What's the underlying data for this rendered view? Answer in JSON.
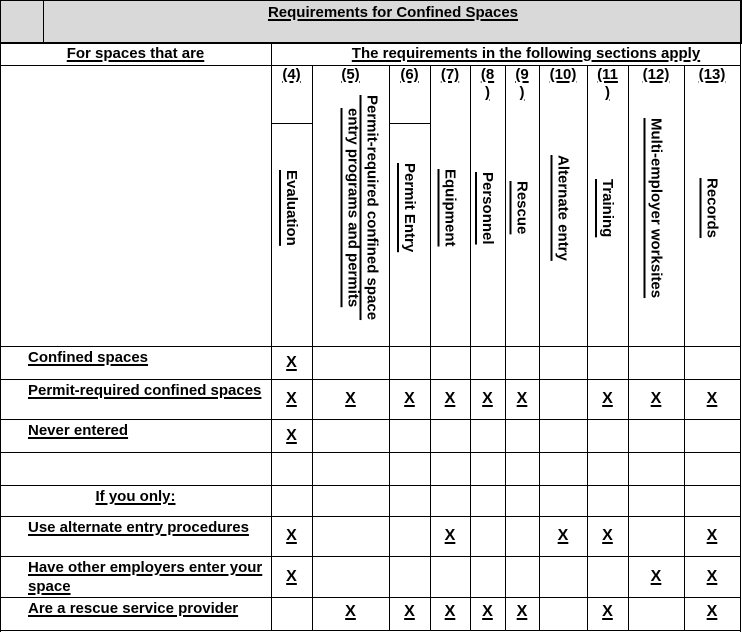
{
  "table": {
    "title": "Requirements for Confined Spaces",
    "left_header": "For spaces that are",
    "right_header": "The requirements in the following sections apply",
    "columns": [
      {
        "number": "(4)",
        "number_lines": [
          "(4)"
        ],
        "label": "Evaluation"
      },
      {
        "number": "(5)",
        "number_lines": [
          "(5)"
        ],
        "label": "Permit-required confined space entry programs and permits"
      },
      {
        "number": "(6)",
        "number_lines": [
          "(6)"
        ],
        "label": "Permit Entry"
      },
      {
        "number": "(7)",
        "number_lines": [
          "(7)"
        ],
        "label": "Equipment"
      },
      {
        "number": "(8)",
        "number_lines": [
          "(8",
          ")"
        ],
        "label": "Personnel"
      },
      {
        "number": "(9)",
        "number_lines": [
          "(9",
          ")"
        ],
        "label": "Rescue"
      },
      {
        "number": "(10)",
        "number_lines": [
          "(10)"
        ],
        "label": "Alternate entry"
      },
      {
        "number": "(11)",
        "number_lines": [
          "(11",
          ")"
        ],
        "label": "Training"
      },
      {
        "number": "(12)",
        "number_lines": [
          "(12)"
        ],
        "label": "Multi-employer worksites"
      },
      {
        "number": "(13)",
        "number_lines": [
          "(13)"
        ],
        "label": "Records"
      }
    ],
    "mark_symbol": "X",
    "rows": [
      {
        "label": "Confined spaces",
        "marks": [
          true,
          false,
          false,
          false,
          false,
          false,
          false,
          false,
          false,
          false
        ]
      },
      {
        "label": "Permit-required confined spaces",
        "marks": [
          true,
          true,
          true,
          true,
          true,
          true,
          false,
          true,
          true,
          true
        ]
      },
      {
        "label": "Never entered",
        "marks": [
          true,
          false,
          false,
          false,
          false,
          false,
          false,
          false,
          false,
          false
        ]
      },
      {
        "label": "",
        "marks": [
          false,
          false,
          false,
          false,
          false,
          false,
          false,
          false,
          false,
          false
        ]
      },
      {
        "label": "If you only:",
        "centered": true,
        "marks": [
          false,
          false,
          false,
          false,
          false,
          false,
          false,
          false,
          false,
          false
        ]
      },
      {
        "label": "Use alternate entry procedures",
        "marks": [
          true,
          false,
          false,
          true,
          false,
          false,
          true,
          true,
          false,
          true
        ]
      },
      {
        "label": "Have other employers  enter your space",
        "marks": [
          true,
          false,
          false,
          false,
          false,
          false,
          false,
          false,
          true,
          true
        ]
      },
      {
        "label": "Are a rescue service provider",
        "marks": [
          false,
          true,
          true,
          true,
          true,
          true,
          false,
          true,
          false,
          true
        ]
      }
    ]
  }
}
